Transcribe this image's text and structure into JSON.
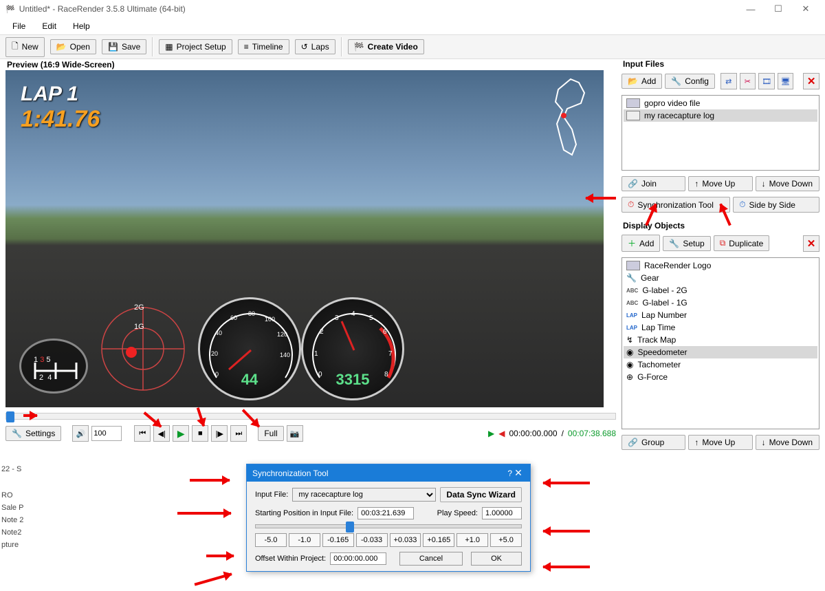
{
  "window": {
    "title": "Untitled* - RaceRender 3.5.8 Ultimate (64-bit)"
  },
  "menu": {
    "file": "File",
    "edit": "Edit",
    "help": "Help"
  },
  "toolbar": {
    "new": "New",
    "open": "Open",
    "save": "Save",
    "project_setup": "Project Setup",
    "timeline": "Timeline",
    "laps": "Laps",
    "create_video": "Create Video"
  },
  "preview": {
    "label": "Preview (16:9 Wide-Screen)",
    "lap_label": "LAP 1",
    "lap_time": "1:41.76",
    "gforce_2g": "2G",
    "gforce_1g": "1G",
    "speed_value": "44",
    "rpm_value": "3315",
    "gear_numbers": "1 3 5\n2 4"
  },
  "playback": {
    "settings": "Settings",
    "volume": "100",
    "full": "Full",
    "pos": "00:00:00.000",
    "dur": "00:07:38.688"
  },
  "input_files": {
    "heading": "Input Files",
    "add": "Add",
    "config": "Config",
    "items": [
      "gopro video file",
      "my racecapture log"
    ],
    "join": "Join",
    "move_up": "Move Up",
    "move_down": "Move Down",
    "sync_tool": "Synchronization Tool",
    "side_by_side": "Side by Side"
  },
  "display_objects": {
    "heading": "Display Objects",
    "add": "Add",
    "setup": "Setup",
    "duplicate": "Duplicate",
    "items": [
      "RaceRender Logo",
      "Gear",
      "G-label - 2G",
      "G-label - 1G",
      "Lap Number",
      "Lap Time",
      "Track Map",
      "Speedometer",
      "Tachometer",
      "G-Force"
    ],
    "group": "Group",
    "move_up": "Move Up",
    "move_down": "Move Down"
  },
  "sync_dialog": {
    "title": "Synchronization Tool",
    "input_file_label": "Input File:",
    "input_file_value": "my racecapture log",
    "wizard": "Data Sync Wizard",
    "start_pos_label": "Starting Position in Input File:",
    "start_pos_value": "00:03:21.639",
    "play_speed_label": "Play Speed:",
    "play_speed_value": "1.00000",
    "steps": [
      "-5.0",
      "-1.0",
      "-0.165",
      "-0.033",
      "+0.033",
      "+0.165",
      "+1.0",
      "+5.0"
    ],
    "offset_label": "Offset Within Project:",
    "offset_value": "00:00:00.000",
    "cancel": "Cancel",
    "ok": "OK"
  },
  "bg_snippets": [
    "22 - S",
    "RO",
    "Sale P",
    "Note 2",
    "Note2",
    "pture"
  ]
}
